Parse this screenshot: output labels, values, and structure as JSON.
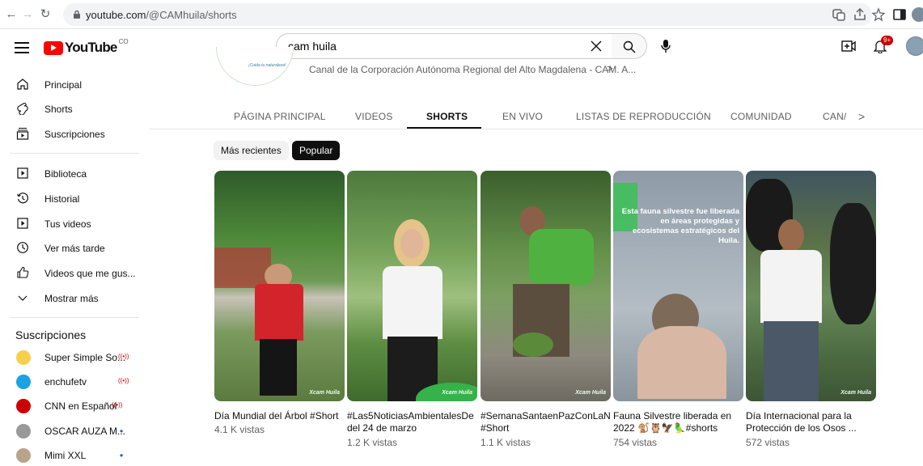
{
  "browser": {
    "url_host": "youtube.com",
    "url_path": "/@CAMhuila/shorts"
  },
  "header": {
    "logo_text": "YouTube",
    "country": "CO",
    "search_value": "cam huila",
    "notification_badge": "9+"
  },
  "sidebar": {
    "main": [
      {
        "label": "Principal",
        "icon": "home-icon"
      },
      {
        "label": "Shorts",
        "icon": "shorts-icon"
      },
      {
        "label": "Suscripciones",
        "icon": "subscriptions-icon"
      }
    ],
    "library": [
      {
        "label": "Biblioteca",
        "icon": "library-icon"
      },
      {
        "label": "Historial",
        "icon": "history-icon"
      },
      {
        "label": "Tus videos",
        "icon": "your-videos-icon"
      },
      {
        "label": "Ver más tarde",
        "icon": "watch-later-icon"
      },
      {
        "label": "Videos que me gus...",
        "icon": "liked-icon"
      },
      {
        "label": "Mostrar más",
        "icon": "chevron-down-icon"
      }
    ],
    "subscriptions_heading": "Suscripciones",
    "subscriptions": [
      {
        "label": "Super Simple So...",
        "status": "live",
        "color": "#f5d04a"
      },
      {
        "label": "enchufetv",
        "status": "live",
        "color": "#1aa3e0"
      },
      {
        "label": "CNN en Español",
        "status": "live",
        "color": "#cc0000"
      },
      {
        "label": "OSCAR AUZA M...",
        "status": "new",
        "color": "#999999"
      },
      {
        "label": "Mimi XXL",
        "status": "new",
        "color": "#b8a48c"
      }
    ]
  },
  "channel": {
    "avatar_tagline": "¡Cuida tu naturaleza!",
    "description": "Canal de la Corporación Autónoma Regional del Alto Magdalena - CAM. A...",
    "tabs": [
      "PÁGINA PRINCIPAL",
      "VIDEOS",
      "SHORTS",
      "EN VIVO",
      "LISTAS DE REPRODUCCIÓN",
      "COMUNIDAD",
      "CAN/"
    ],
    "active_tab": "SHORTS"
  },
  "chips": {
    "recent": "Más recientes",
    "popular": "Popular",
    "active": "Popular"
  },
  "watermark": "Xcam Huila",
  "shorts": [
    {
      "title": "Día Mundial del Árbol #Short",
      "views": "4.1 K vistas"
    },
    {
      "title": "#Las5NoticiasAmbientalesDe del 24 de marzo",
      "views": "1.2 K vistas"
    },
    {
      "title": "#SemanaSantaenPazConLaNa #Short",
      "views": "1.1 K vistas"
    },
    {
      "title": "Fauna Silvestre liberada en 2022 🐒🦉🦅🦜#shorts",
      "views": "754 vistas",
      "overlay": "Esta fauna silvestre fue liberada en áreas protegidas y ecosistemas estratégicos del Huila."
    },
    {
      "title": "Día Internacional para la Protección de los Osos ...",
      "views": "572 vistas"
    }
  ]
}
